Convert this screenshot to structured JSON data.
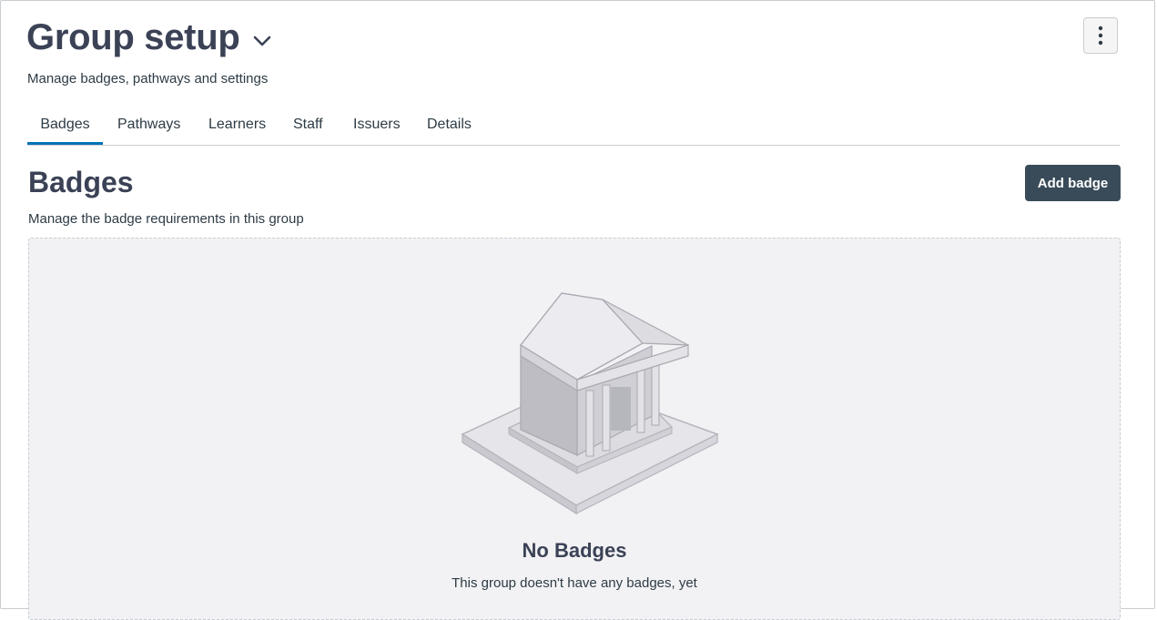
{
  "header": {
    "title": "Group setup",
    "subtitle": "Manage badges, pathways and settings"
  },
  "tabs": [
    {
      "label": "Badges",
      "active": true
    },
    {
      "label": "Pathways",
      "active": false
    },
    {
      "label": "Learners",
      "active": false
    },
    {
      "label": "Staff",
      "active": false
    },
    {
      "label": "Issuers",
      "active": false
    },
    {
      "label": "Details",
      "active": false
    }
  ],
  "section": {
    "title": "Badges",
    "subtitle": "Manage the badge requirements in this group",
    "add_label": "Add badge"
  },
  "empty_state": {
    "title": "No Badges",
    "message": "This group doesn't have any badges, yet"
  },
  "colors": {
    "accent": "#0374b5",
    "button": "#394b58",
    "heading": "#3b4256"
  },
  "icons": {
    "title_toggle": "chevron-down-icon",
    "options": "kebab-menu-icon",
    "empty": "building-icon"
  }
}
